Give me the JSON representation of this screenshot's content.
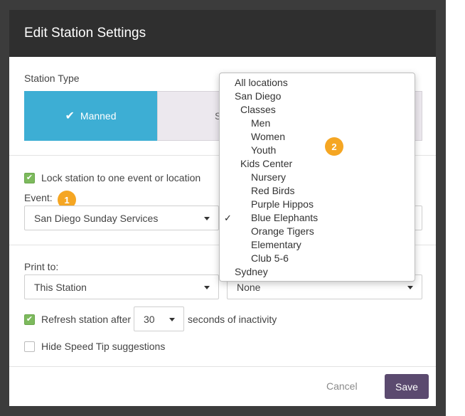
{
  "modal": {
    "title": "Edit Station Settings"
  },
  "station_type": {
    "label": "Station Type",
    "manned_label": "Manned",
    "other_label_visible": "S"
  },
  "lock": {
    "checked": true,
    "label": "Lock station to one event or location"
  },
  "event": {
    "label": "Event:",
    "value": "San Diego Sunday Services"
  },
  "print": {
    "label": "Print to:",
    "value": "This Station",
    "secondary_value": "None"
  },
  "refresh": {
    "checked": true,
    "label_before": "Refresh station after",
    "seconds_value": "30",
    "label_after": "seconds of inactivity"
  },
  "speed_tip": {
    "checked": false,
    "label": "Hide Speed Tip suggestions"
  },
  "footer": {
    "cancel_label": "Cancel",
    "save_label": "Save"
  },
  "badges": {
    "one": "1",
    "two": "2",
    "color": "#f5a623"
  },
  "location_dropdown": {
    "selected": "Blue Elephants",
    "options": [
      "All locations",
      "San Diego",
      "Classes",
      "Men",
      "Women",
      "Youth",
      "Kids Center",
      "Nursery",
      "Red Birds",
      "Purple Hippos",
      "Blue Elephants",
      "Orange Tigers",
      "Elementary",
      "Club 5-6",
      "Sydney"
    ]
  },
  "colors": {
    "accent": "#3daed4",
    "header": "#2f2f2f",
    "save": "#5b4a6f",
    "checkbox_on": "#7dba5d"
  },
  "icons": {
    "checkmark": "checkmark-icon",
    "caret": "caret-down-icon"
  }
}
